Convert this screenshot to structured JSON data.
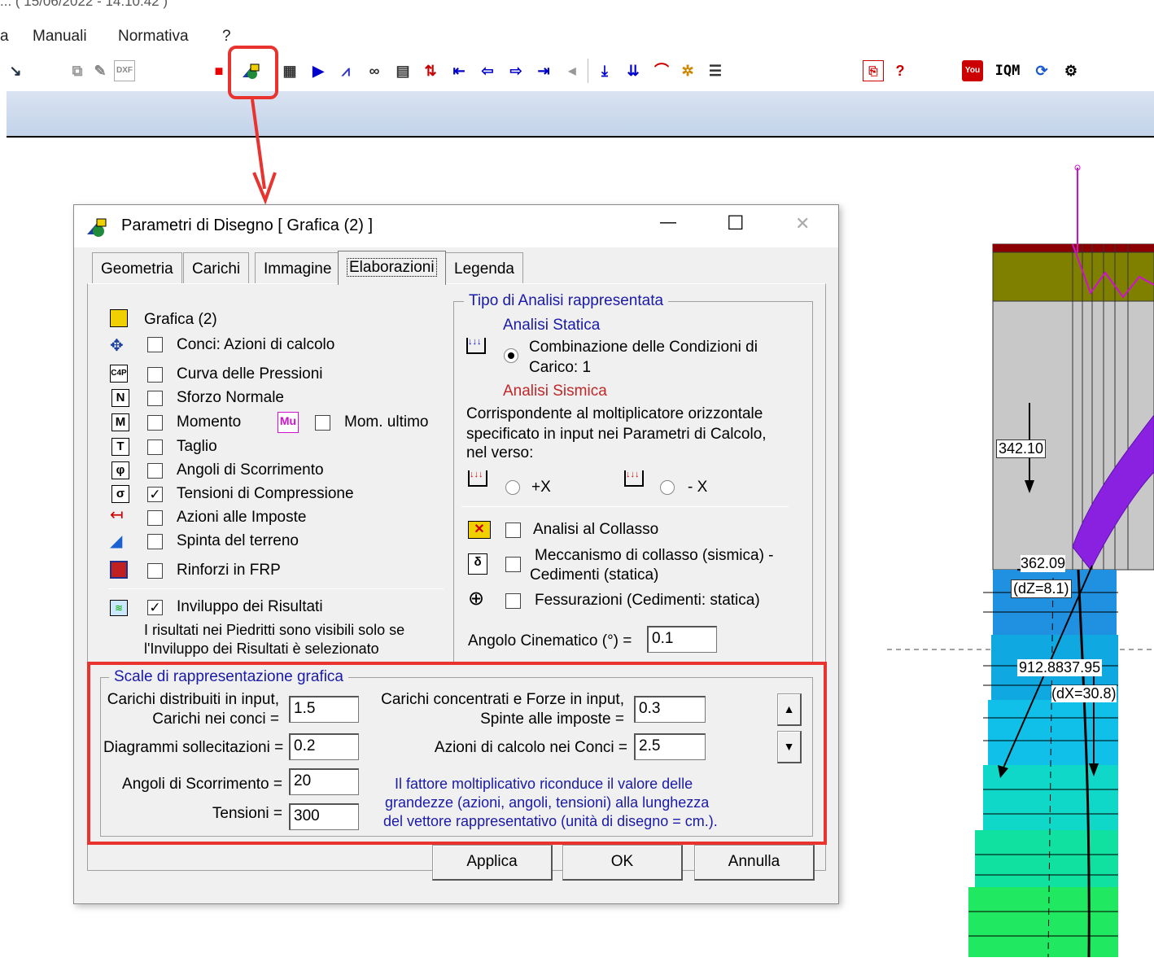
{
  "window": {
    "title_fragment": "... ( 15/06/2022 - 14.10.42 )"
  },
  "menu": {
    "items": [
      "a",
      "Manuali",
      "Normativa",
      "?"
    ]
  },
  "toolbar": {
    "icons": [
      "cursor-icon",
      "copy-icon",
      "edit-icon",
      "dxf-icon",
      "delete-icon",
      "drawing-parameters-icon",
      "calculator-icon",
      "arrow-icon",
      "graph-icon",
      "view-icon",
      "table-icon",
      "distribute-icon",
      "first-icon",
      "previous-icon",
      "next-icon",
      "last-icon",
      "scroll-left-icon",
      "load-down-icon",
      "load-multiple-icon",
      "arch-icon",
      "settings-icon",
      "report-icon",
      "pdf-icon",
      "help-icon",
      "youtube-icon",
      "iqm-icon",
      "refresh-icon",
      "gear-icon"
    ],
    "iqm_label": "IQM"
  },
  "dialog": {
    "title": "Parametri di Disegno [ Grafica (2) ]",
    "controls": {
      "minimize": "—",
      "maximize": "☐",
      "close": "✕"
    },
    "tabs": [
      {
        "label": "Geometria"
      },
      {
        "label": "Carichi"
      },
      {
        "label": "Immagine"
      },
      {
        "label": "Elaborazioni"
      },
      {
        "label": "Legenda"
      }
    ],
    "left": {
      "header": "Grafica (2)",
      "items": [
        {
          "label": "Conci: Azioni di calcolo",
          "checked": false
        },
        {
          "label": "Curva delle Pressioni",
          "checked": false,
          "icon": "C4P"
        },
        {
          "label": "Sforzo Normale",
          "checked": false,
          "icon": "N"
        },
        {
          "label": "Momento",
          "checked": false,
          "icon": "M"
        },
        {
          "label": "Taglio",
          "checked": false,
          "icon": "T"
        },
        {
          "label": "Angoli di Scorrimento",
          "checked": false,
          "icon": "φ"
        },
        {
          "label": "Tensioni di Compressione",
          "checked": true,
          "icon": "σ"
        },
        {
          "label": "Azioni alle Imposte",
          "checked": false
        },
        {
          "label": "Spinta del terreno",
          "checked": false
        },
        {
          "label": "Rinforzi in FRP",
          "checked": false
        }
      ],
      "mom_ultimo": {
        "label": "Mom. ultimo",
        "checked": false,
        "icon": "Mu"
      },
      "inviluppo": {
        "label": "Inviluppo dei Risultati",
        "checked": true
      },
      "note_line1": "I risultati nei Piedritti sono visibili solo se",
      "note_line2": "l'Inviluppo dei Risultati è selezionato"
    },
    "right": {
      "group_title": "Tipo di Analisi rappresentata",
      "statica_title": "Analisi Statica",
      "combinazione_line1": "Combinazione delle Condizioni di",
      "combinazione_line2": "Carico: 1",
      "sismica_title": "Analisi Sismica",
      "sismica_line1": "Corrispondente al moltiplicatore orizzontale",
      "sismica_line2": "specificato in input nei Parametri di Calcolo,",
      "sismica_line3": "nel verso:",
      "plus_x": "+X",
      "minus_x": "- X",
      "collasso": {
        "label": "Analisi al Collasso",
        "checked": false
      },
      "meccanismo_line1": "Meccanismo di collasso (sismica) -",
      "meccanismo_line2": "Cedimenti (statica)",
      "fessurazioni": {
        "label": "Fessurazioni (Cedimenti: statica)",
        "checked": false
      },
      "angolo_label": "Angolo Cinematico (°) =",
      "angolo_value": "0.1"
    },
    "scales": {
      "title": "Scale di rappresentazione grafica",
      "distribuiti_line1": "Carichi distribuiti in input,",
      "distribuiti_line2": "Carichi nei conci =",
      "distribuiti_value": "1.5",
      "concentrati_line1": "Carichi concentrati e Forze in input,",
      "concentrati_line2": "Spinte alle imposte =",
      "concentrati_value": "0.3",
      "diagrammi_label": "Diagrammi sollecitazioni =",
      "diagrammi_value": "0.2",
      "azioni_label": "Azioni di calcolo nei Conci =",
      "azioni_value": "2.5",
      "angoli_label": "Angoli di Scorrimento =",
      "angoli_value": "20",
      "tensioni_label": "Tensioni =",
      "tensioni_value": "300",
      "info_line1": "Il fattore moltiplicativo riconduce il valore delle",
      "info_line2": "grandezze (azioni, angoli, tensioni) alla lunghezza",
      "info_line3": "del vettore rappresentativo (unità di disegno = cm.)."
    },
    "buttons": {
      "apply": "Applica",
      "ok": "OK",
      "cancel": "Annulla"
    }
  },
  "drawing": {
    "labels": [
      "342.10",
      "362.09",
      "(dZ=8.1)",
      "912.8837.95",
      "(dX=30.8)"
    ]
  },
  "colors": {
    "highlight": "#e8332f",
    "blue_text": "#1a1aa8",
    "red_text": "#c0282a",
    "magenta": "#d010d0"
  }
}
